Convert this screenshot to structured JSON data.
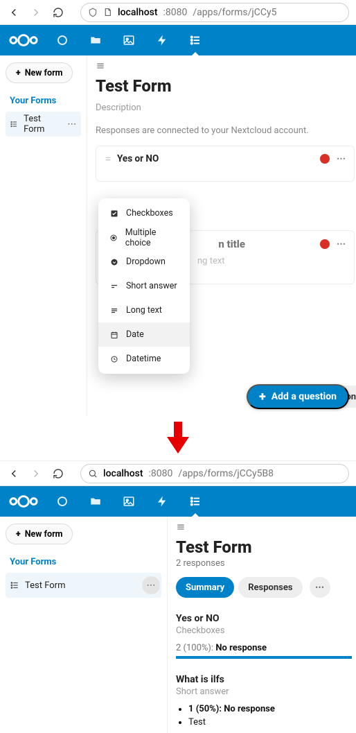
{
  "top": {
    "url_pre": "localhost",
    "url_port": ":8080",
    "url_path": "/apps/forms/jCCy5",
    "sidebar": {
      "new_form": "New form",
      "heading": "Your Forms",
      "item": "Test Form"
    },
    "form": {
      "title": "Test Form",
      "description": "Description",
      "hint": "Responses are connected to your Nextcloud account."
    },
    "q1": {
      "title": "Yes or NO"
    },
    "q2": {
      "title_placeholder": "n title",
      "subhint": "ng text"
    },
    "add_label": "Add a question",
    "peek_label": "stion title",
    "popover": [
      "Checkboxes",
      "Multiple choice",
      "Dropdown",
      "Short answer",
      "Long text",
      "Date",
      "Datetime"
    ]
  },
  "bottom": {
    "url_pre": "localhost",
    "url_port": ":8080",
    "url_path": "/apps/forms/jCCy5B8",
    "sidebar": {
      "new_form": "New form",
      "heading": "Your Forms",
      "item": "Test Form"
    },
    "form": {
      "title": "Test Form",
      "responses": "2 responses"
    },
    "tabs": {
      "summary": "Summary",
      "responses": "Responses"
    },
    "q1": {
      "title": "Yes or NO",
      "type": "Checkboxes",
      "count": "2",
      "pct": "(100%):",
      "label": "No response"
    },
    "q2": {
      "title": "What is ilfs",
      "type": "Short answer",
      "line1_pct": "1 (50%):",
      "line1_label": "No response",
      "line2": "Test"
    }
  }
}
